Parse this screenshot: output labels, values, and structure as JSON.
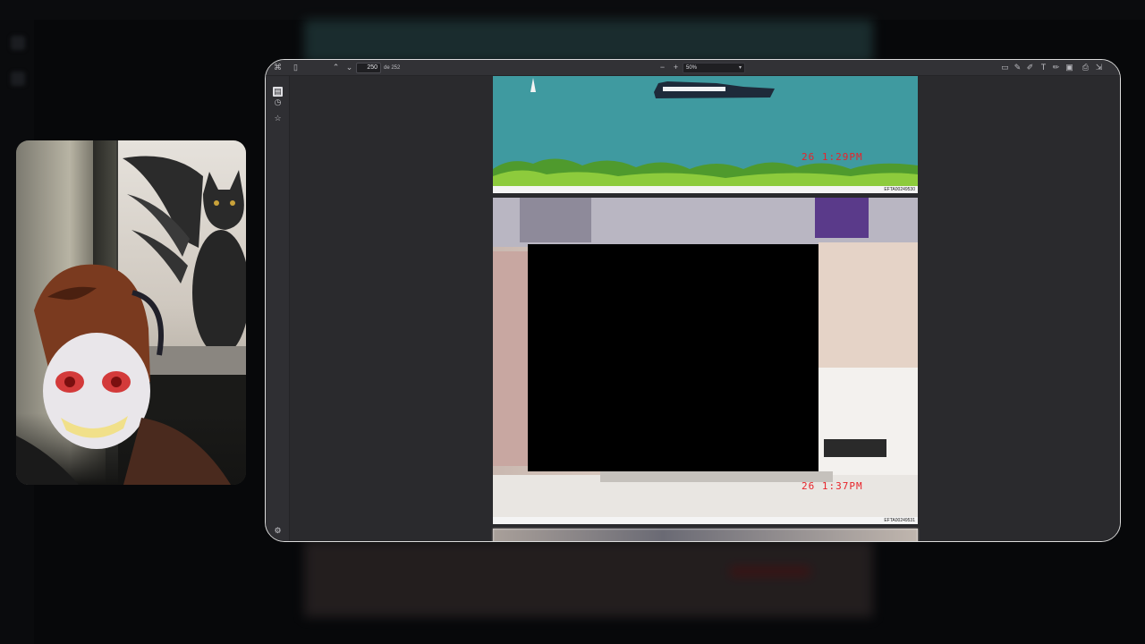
{
  "viewer": {
    "current_page": "250",
    "page_total_label": "de 252",
    "zoom": "50%",
    "zoom_out": "−",
    "zoom_in": "+"
  },
  "toolbar_icons": {
    "sidebar_toggle": "sidebar-toggle-icon",
    "prev_page": "chevron-up-icon",
    "next_page": "chevron-down-icon",
    "right": [
      "comment-icon",
      "edit-page-icon",
      "highlight-icon",
      "text-icon",
      "draw-icon",
      "image-icon",
      "print-icon",
      "save-icon"
    ]
  },
  "rail_icons": [
    "thumbnails-icon",
    "history-icon",
    "star-icon"
  ],
  "pages": [
    {
      "stamp": "26  1:29PM",
      "bates": "EFTA00249530"
    },
    {
      "stamp": "26  1:37PM",
      "bates": "EFTA00249531"
    }
  ],
  "colors": {
    "stamp_red": "#e8232a",
    "viewer_bg": "#2b2b2e",
    "toolbar_bg": "#323236",
    "sea": "#3d9499"
  }
}
